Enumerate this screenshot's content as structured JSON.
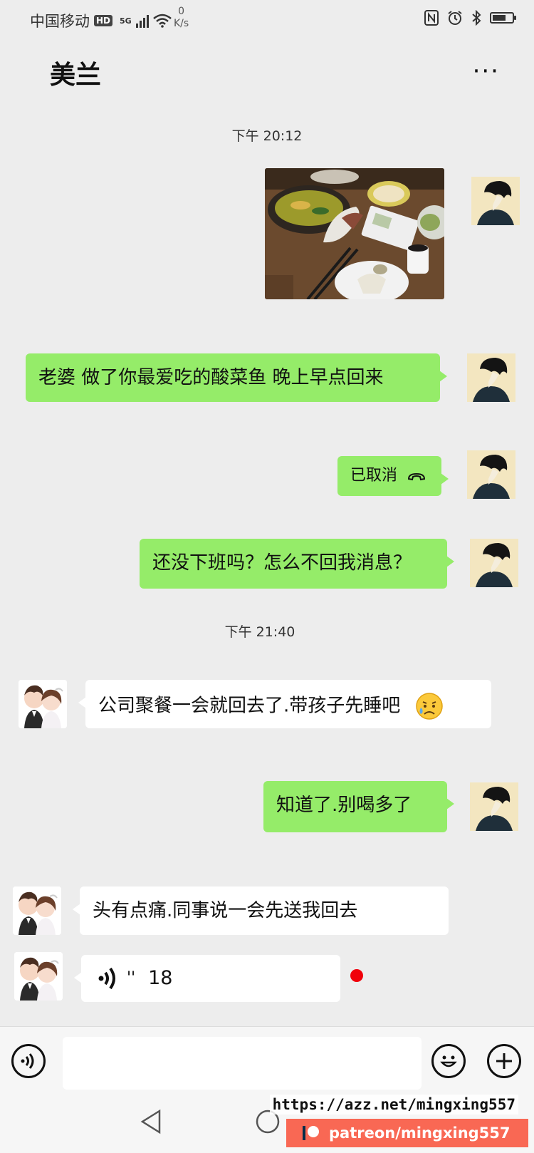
{
  "status_bar": {
    "carrier": "中国移动",
    "hd_badge": "HD",
    "network": "5G",
    "speed_value": "0",
    "speed_unit": "K/s",
    "icons": [
      "nfc-icon",
      "alarm-icon",
      "bluetooth-icon",
      "battery-icon"
    ],
    "battery_level": 0.7
  },
  "header": {
    "title": "美兰",
    "more_label": "···"
  },
  "timestamps": [
    "下午 20:12",
    "下午 21:40"
  ],
  "messages": {
    "m1_text": "老婆  做了你最爱吃的酸菜鱼 晚上早点回来",
    "m2_call": "已取消",
    "m3_text": "还没下班吗？怎么不回我消息？",
    "m4_text": "公司聚餐一会就回去了.带孩子先睡吧",
    "m5_text": "知道了.别喝多了",
    "m6_text": "头有点痛.同事说一会先送我回去",
    "m7_voice_duration": "18",
    "m7_voice_mark": "''"
  },
  "input_bar": {
    "placeholder": "",
    "icons": [
      "voice-icon",
      "emoji-icon",
      "plus-icon"
    ]
  },
  "watermark": {
    "url": "https://azz.net/mingxing557",
    "patreon": "patreon/mingxing557"
  },
  "colors": {
    "background": "#ededed",
    "my_bubble": "#95ec69",
    "their_bubble": "#ffffff",
    "unread_dot": "#f0000a",
    "patreon": "#f96854"
  }
}
